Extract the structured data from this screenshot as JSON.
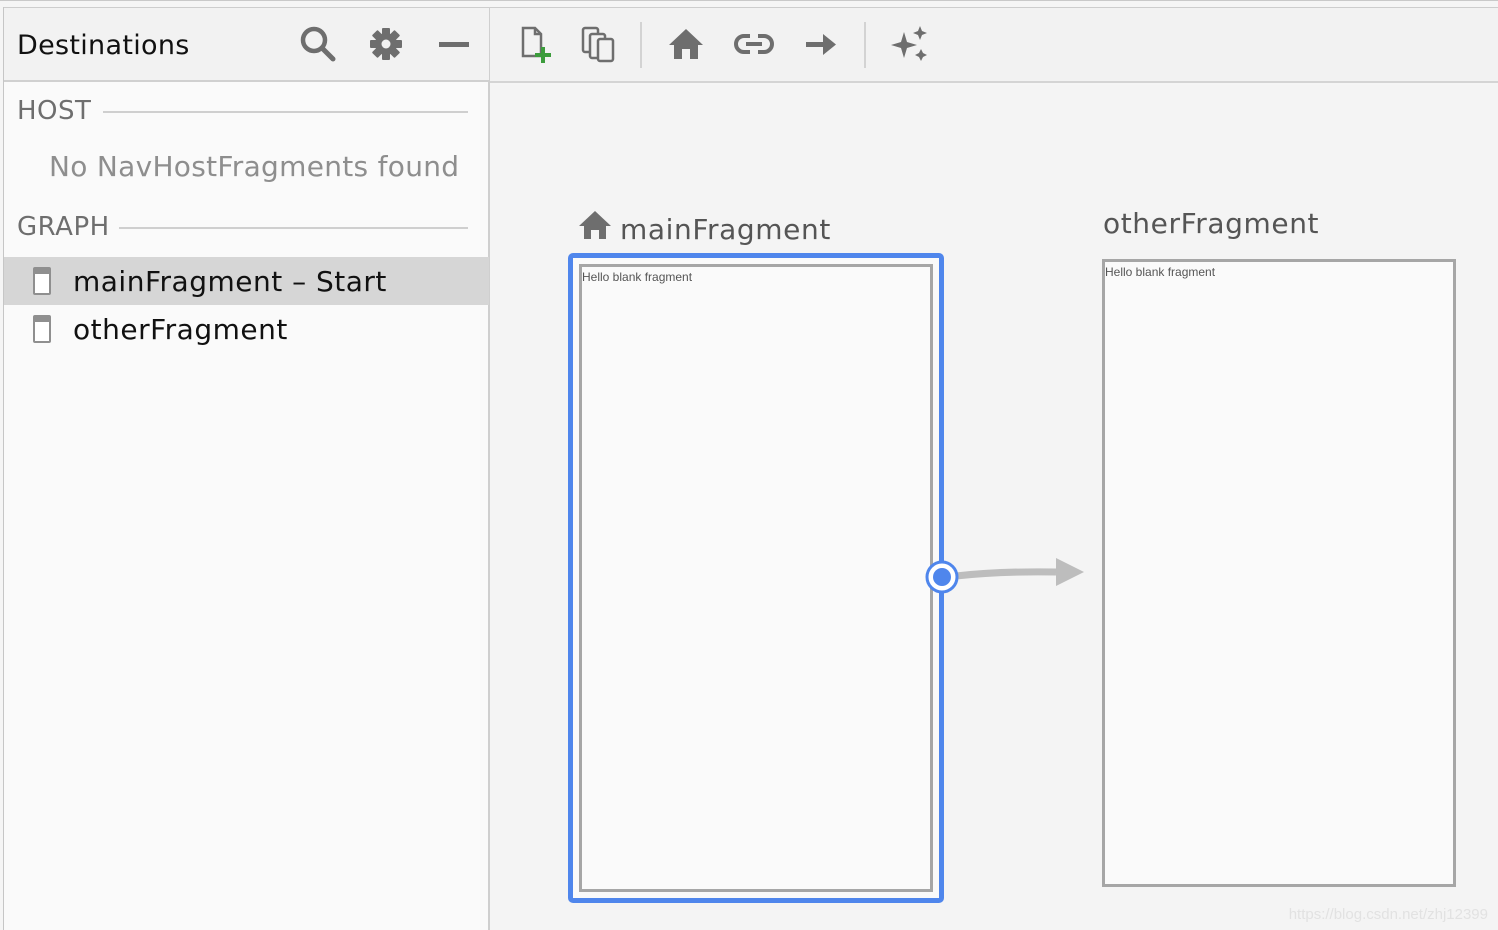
{
  "destinations_panel": {
    "title": "Destinations",
    "header_icons": [
      "search-icon",
      "gear-icon",
      "minimize-icon"
    ],
    "host_section": {
      "label": "HOST",
      "empty_message": "No NavHostFragments found"
    },
    "graph_section": {
      "label": "GRAPH",
      "items": [
        {
          "label": "mainFragment – Start",
          "selected": true
        },
        {
          "label": "otherFragment",
          "selected": false
        }
      ]
    }
  },
  "toolbar": {
    "buttons": [
      "new-destination-icon",
      "nested-graph-icon",
      "home-icon",
      "deep-link-icon",
      "action-arrow-icon",
      "auto-arrange-icon"
    ]
  },
  "canvas": {
    "destinations": [
      {
        "title": "mainFragment",
        "preview_text": "Hello blank fragment",
        "is_start": true,
        "selected": true
      },
      {
        "title": "otherFragment",
        "preview_text": "Hello blank fragment",
        "is_start": false,
        "selected": false
      }
    ],
    "action": {
      "from": "mainFragment",
      "to": "otherFragment"
    }
  },
  "colors": {
    "selection_blue": "#4f86ec",
    "add_green": "#3c9c3c",
    "icon_gray": "#6e6e6e"
  },
  "watermark": "https://blog.csdn.net/zhj12399"
}
